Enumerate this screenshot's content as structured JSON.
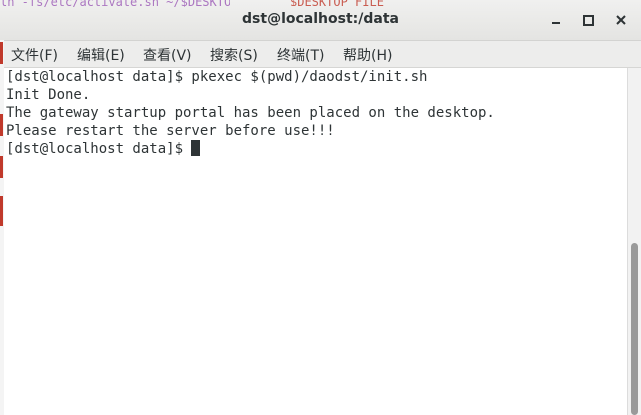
{
  "window": {
    "title": "dst@localhost:/data"
  },
  "background_editor": {
    "top_left_text": "ln -fs/etc/activate.sh ~/$DESKTOP_FILE",
    "top_right_text": "$DESKTOP_FILE"
  },
  "menu": {
    "items": [
      {
        "label": "文件(F)"
      },
      {
        "label": "编辑(E)"
      },
      {
        "label": "查看(V)"
      },
      {
        "label": "搜索(S)"
      },
      {
        "label": "终端(T)"
      },
      {
        "label": "帮助(H)"
      }
    ]
  },
  "terminal": {
    "lines": [
      "[dst@localhost data]$ pkexec $(pwd)/daodst/init.sh",
      "Init Done.",
      "The gateway startup portal has been placed on the desktop.",
      "Please restart the server before use!!!"
    ],
    "prompt": "[dst@localhost data]$ "
  },
  "icons": {
    "minimize": "minimize-icon",
    "maximize": "maximize-icon",
    "close": "close-icon"
  },
  "colors": {
    "terminal_bg": "#ffffff",
    "terminal_fg": "#2e3436",
    "titlebar_bg": "#e8e8e7"
  }
}
